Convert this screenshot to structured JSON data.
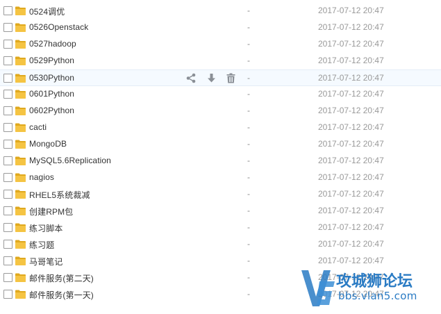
{
  "files": [
    {
      "name": "0524调优",
      "size": "-",
      "date": "2017-07-12 20:47"
    },
    {
      "name": "0526Openstack",
      "size": "-",
      "date": "2017-07-12 20:47"
    },
    {
      "name": "0527hadoop",
      "size": "-",
      "date": "2017-07-12 20:47"
    },
    {
      "name": "0529Python",
      "size": "-",
      "date": "2017-07-12 20:47"
    },
    {
      "name": "0530Python",
      "size": "-",
      "date": "2017-07-12 20:47"
    },
    {
      "name": "0601Python",
      "size": "-",
      "date": "2017-07-12 20:47"
    },
    {
      "name": "0602Python",
      "size": "-",
      "date": "2017-07-12 20:47"
    },
    {
      "name": "cacti",
      "size": "-",
      "date": "2017-07-12 20:47"
    },
    {
      "name": "MongoDB",
      "size": "-",
      "date": "2017-07-12 20:47"
    },
    {
      "name": "MySQL5.6Replication",
      "size": "-",
      "date": "2017-07-12 20:47"
    },
    {
      "name": "nagios",
      "size": "-",
      "date": "2017-07-12 20:47"
    },
    {
      "name": "RHEL5系统裁减",
      "size": "-",
      "date": "2017-07-12 20:47"
    },
    {
      "name": "创建RPM包",
      "size": "-",
      "date": "2017-07-12 20:47"
    },
    {
      "name": "练习脚本",
      "size": "-",
      "date": "2017-07-12 20:47"
    },
    {
      "name": "练习题",
      "size": "-",
      "date": "2017-07-12 20:47"
    },
    {
      "name": "马哥笔记",
      "size": "-",
      "date": "2017-07-12 20:47"
    },
    {
      "name": "邮件服务(第二天)",
      "size": "-",
      "date": "2017-07-12 20:47"
    },
    {
      "name": "邮件服务(第一天)",
      "size": "-",
      "date": "2017-07-12 20:47"
    }
  ],
  "hover_row_actions": [
    "share-icon",
    "download-icon",
    "delete-icon"
  ],
  "watermark": {
    "title": "攻城狮论坛",
    "url": "bbs.vlan5.com"
  },
  "colors": {
    "folder": "#f5c443",
    "folder_dark": "#e0a91f",
    "hover_row": "#f5faff",
    "action_icon": "#8a8f96",
    "watermark": "#2a7bc4"
  }
}
